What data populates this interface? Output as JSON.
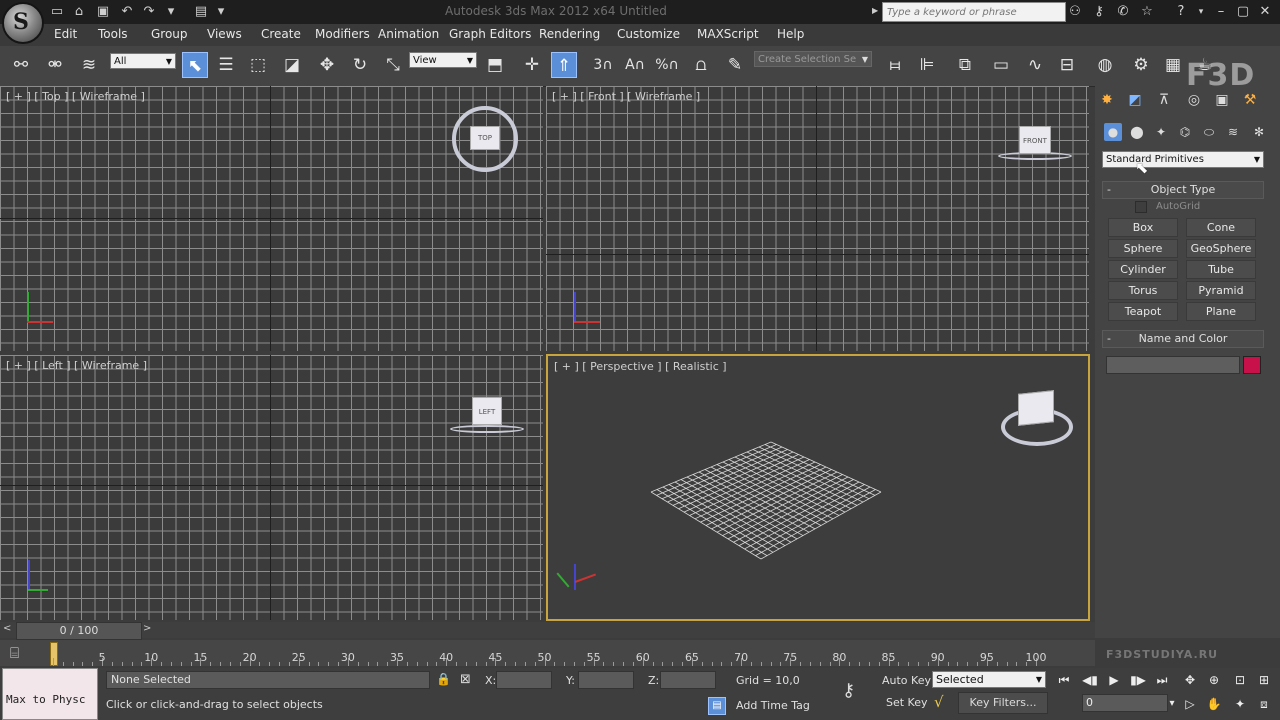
{
  "title_bar": {
    "title": "Autodesk 3ds Max 2012 x64      Untitled",
    "search_placeholder": "Type a keyword or phrase",
    "logo_letter": "S"
  },
  "menu": [
    "Edit",
    "Tools",
    "Group",
    "Views",
    "Create",
    "Modifiers",
    "Animation",
    "Graph Editors",
    "Rendering",
    "Customize",
    "MAXScript",
    "Help"
  ],
  "toolbar": {
    "selection_filter": "All",
    "reference_coord": "View",
    "named_selection_placeholder": "Create Selection Se",
    "snap_label": "3",
    "angle_snap_label": "A",
    "percent_label": "%"
  },
  "watermark": "F3D",
  "viewports": {
    "top": {
      "label": "[ + ] [ Top ] [ Wireframe ]",
      "cube": "TOP"
    },
    "front": {
      "label": "[ + ] [ Front ] [ Wireframe ]",
      "cube": "FRONT"
    },
    "left": {
      "label": "[ + ] [ Left ] [ Wireframe ]",
      "cube": "LEFT"
    },
    "perspective": {
      "label": "[ + ] [ Perspective ] [ Realistic ]"
    }
  },
  "command_panel": {
    "category": "Standard Primitives",
    "object_type_title": "Object Type",
    "autogrid_label": "AutoGrid",
    "primitives": [
      "Box",
      "Cone",
      "Sphere",
      "GeoSphere",
      "Cylinder",
      "Tube",
      "Torus",
      "Pyramid",
      "Teapot",
      "Plane"
    ],
    "name_color_title": "Name and Color",
    "object_color": "#c8104a",
    "rollout_minus": "-"
  },
  "timeline": {
    "frame_display": "0 / 100",
    "prev_arrow": "<",
    "next_arrow": ">",
    "frames": [
      5,
      10,
      15,
      20,
      25,
      30,
      35,
      40,
      45,
      50,
      55,
      60,
      65,
      70,
      75,
      80,
      85,
      90,
      95,
      100
    ],
    "site_watermark": "F3DSTUDIYA.RU"
  },
  "status": {
    "maxscript_listener": "Max to Physc",
    "selection": "None Selected",
    "prompt": "Click or click-and-drag to select objects",
    "x_label": "X:",
    "y_label": "Y:",
    "z_label": "Z:",
    "grid": "Grid = 10,0",
    "add_time_tag": "Add Time Tag",
    "auto_key": "Auto Key",
    "set_key": "Set Key",
    "key_mode": "Selected",
    "key_filters": "Key Filters...",
    "current_frame": "0"
  }
}
